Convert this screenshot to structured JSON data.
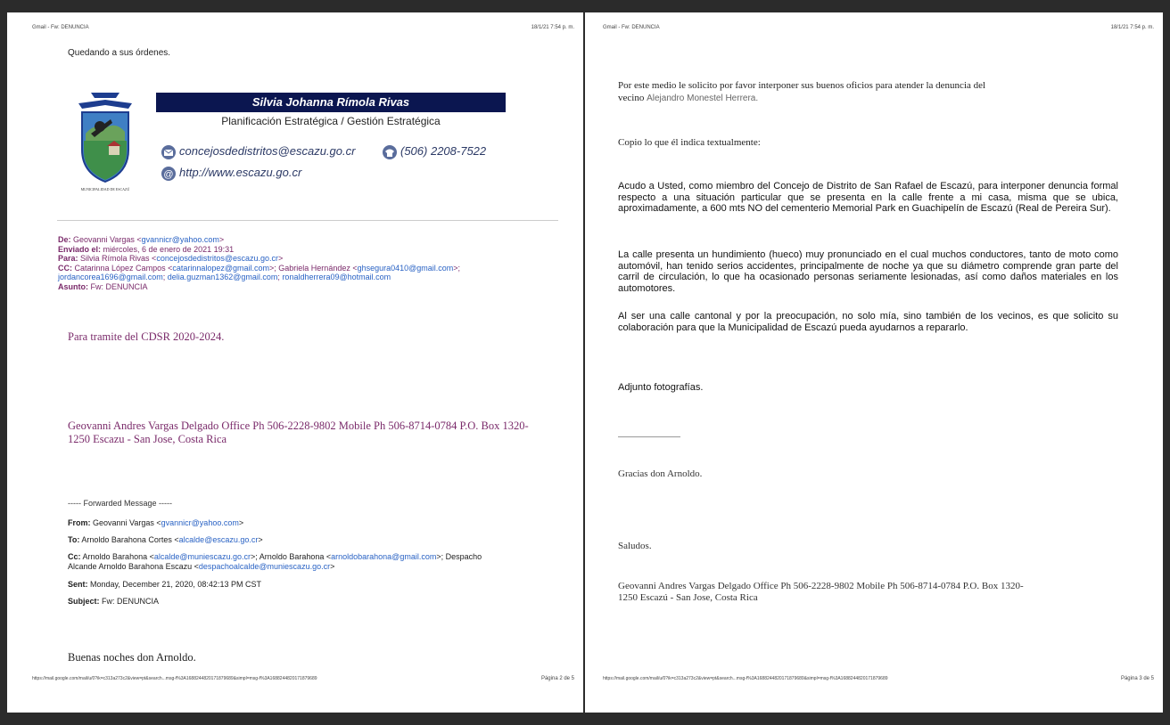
{
  "left": {
    "header_left": "Gmail - Fw: DENUNCIA",
    "header_right": "18/1/21 7:54 p. m.",
    "closing": "Quedando a sus órdenes.",
    "signature": {
      "name": "Silvia Johanna Rímola Rivas",
      "role": "Planificación Estratégica / Gestión Estratégica",
      "email": "concejosdedistritos@escazu.go.cr",
      "phone": "(506) 2208-7522",
      "web": "http://www.escazu.go.cr",
      "logo_caption": "MUNICIPALIDAD DE ESCAZÚ"
    },
    "orig": {
      "de_label": "De:",
      "de_name": "Geovanni Vargas <",
      "de_email": "gvannicr@yahoo.com",
      "de_end": ">",
      "enviado_label": "Enviado el:",
      "enviado": "miércoles, 6 de enero de 2021 19:31",
      "para_label": "Para:",
      "para_name": "Silvia Rímola Rivas <",
      "para_email": "concejosdedistritos@escazu.go.cr",
      "para_end": ">",
      "cc_label": "CC:",
      "cc_1": "Catarinna López Campos <",
      "cc_1_email": "catarinnalopez@gmail.com",
      "cc_2": ">; Gabriela Hernández <",
      "cc_2_email": "ghsegura0410@gmail.com",
      "cc_3": ">;",
      "cc_4_email": "jordancorea1696@gmail.com",
      "cc_5_email": "delia.guzman1362@gmail.com",
      "cc_6_email": "ronaldherrera09@hotmail.com",
      "asunto_label": "Asunto:",
      "asunto": "Fw: DENUNCIA"
    },
    "tramite": "Para tramite del CDSR 2020-2024.",
    "sender_sig_1": "Geovanni Andres Vargas Delgado Office Ph 506-2228-9802 Mobile Ph 506-8714-0784 P.O. Box 1320-",
    "sender_sig_2": "1250 Escazu - San Jose, Costa Rica",
    "forwarded": "----- Forwarded Message -----",
    "fwd": {
      "from_label": "From:",
      "from": "Geovanni Vargas <",
      "from_email": "gvannicr@yahoo.com",
      "from_end": ">",
      "to_label": "To:",
      "to": "Arnoldo Barahona Cortes <",
      "to_email": "alcalde@escazu.go.cr",
      "to_end": ">",
      "cc_label": "Cc:",
      "cc_a": "Arnoldo Barahona <",
      "cc_a_email": "alcalde@muniescazu.go.cr",
      "cc_b": ">; Arnoldo Barahona <",
      "cc_b_email": "arnoldobarahona@gmail.com",
      "cc_c": ">; Despacho",
      "cc_d": "Alcande Arnoldo Barahona Escazu <",
      "cc_d_email": "despachoalcalde@muniescazu.go.cr",
      "cc_end": ">",
      "sent_label": "Sent:",
      "sent": "Monday, December 21, 2020, 08:42:13 PM CST",
      "subject_label": "Subject:",
      "subject": "Fw: DENUNCIA"
    },
    "greeting": "Buenas noches don Arnoldo.",
    "footer_url": "https://mail.google.com/mail/u/0?ik=c313a273c2&view=pt&search...msg-f%3A1688244820171879689&simpl=msg-f%3A1688244820171879689",
    "footer_page": "Página 2 de 5"
  },
  "right": {
    "header_left": "Gmail - Fw: DENUNCIA",
    "header_right": "18/1/21 7:54 p. m.",
    "intro_1": "Por este medio le solicito por favor interponer sus buenos oficios para atender la denuncia del",
    "intro_2": "vecino ",
    "intro_name": "Alejandro Monestel Herrera.",
    "copio": "Copio lo que él indica textualmente:",
    "para1": "Acudo a Usted, como miembro del Concejo de Distrito de San Rafael de Escazú, para interponer denuncia formal respecto a una situación particular que se presenta en la calle frente a mi casa, misma que se ubica, aproximadamente, a 600 mts NO del cementerio Memorial Park en Guachipelín de Escazú (Real de Pereira Sur).",
    "para2": "La calle presenta un hundimiento (hueco) muy pronunciado en el cual muchos conductores, tanto de moto como automóvil, han tenido serios accidentes, principalmente de noche ya que su diámetro comprende gran parte del carril de circulación, lo que ha ocasionado personas seriamente lesionadas, así como daños materiales en los automotores.",
    "para3": "Al ser una calle cantonal y por la preocupación, no solo mía, sino también de los vecinos, es que solicito su colaboración para que la Municipalidad de Escazú pueda ayudarnos a repararlo.",
    "adjunto": "Adjunto fotografías.",
    "separator": "________________",
    "gracias": "Gracias don Arnoldo.",
    "saludos": "Saludos.",
    "sender_sig_1": "Geovanni Andres Vargas Delgado Office Ph 506-2228-9802 Mobile Ph 506-8714-0784 P.O. Box 1320-",
    "sender_sig_2": "1250 Escazú - San Jose, Costa Rica",
    "footer_url": "https://mail.google.com/mail/u/0?ik=c313a273c2&view=pt&search...msg-f%3A1688244820171879689&simpl=msg-f%3A1688244820171879689",
    "footer_page": "Página 3 de 5"
  },
  "colors": {
    "background": "#2b2b2b",
    "sig_bar": "#0b1650",
    "link": "#2962c4",
    "purple": "#7a2a6a"
  }
}
